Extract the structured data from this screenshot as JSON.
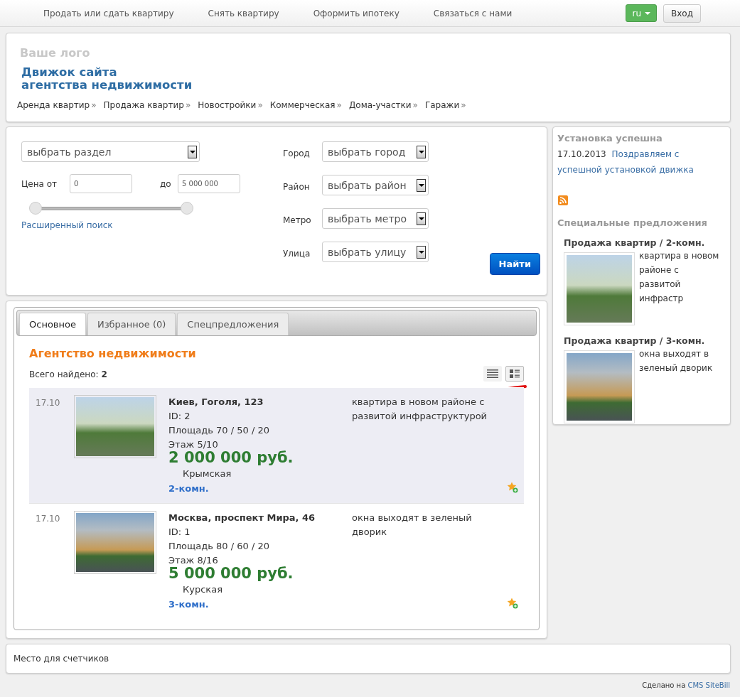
{
  "top_nav": {
    "links": [
      "Продать или сдать квартиру",
      "Снять квартиру",
      "Оформить ипотеку",
      "Связаться с нами"
    ],
    "language": "ru",
    "login": "Вход"
  },
  "header": {
    "logo": "Ваше лого",
    "title_lines": [
      "Движок сайта",
      "агентства недвижимости"
    ],
    "menu": [
      "Аренда квартир",
      "Продажа квартир",
      "Новостройки",
      "Коммерческая",
      "Дома-участки",
      "Гаражи"
    ],
    "menu_arrow": "»"
  },
  "search": {
    "section": {
      "value": "выбрать раздел"
    },
    "price_from": {
      "label": "Цена от",
      "value": "0"
    },
    "price_to": {
      "label": "до",
      "value": "5 000 000"
    },
    "slider": {
      "thumbs": [
        {
          "level": 0
        },
        {
          "level": 1
        }
      ]
    },
    "advanced_link": "Расширенный поиск",
    "filters": [
      {
        "label": "Город",
        "value": "выбрать город"
      },
      {
        "label": "Район",
        "value": "выбрать район"
      },
      {
        "label": "Метро",
        "value": "выбрать метро"
      },
      {
        "label": "Улица",
        "value": "выбрать улицу"
      }
    ],
    "submit": "Найти"
  },
  "tabs": [
    {
      "label": "Основное",
      "selected": true
    },
    {
      "label": "Избранное (0)",
      "selected": false
    },
    {
      "label": "Спецпредложения",
      "selected": false
    }
  ],
  "listing": {
    "heading": "Агентство недвижимости",
    "total_label": "Всего найдено:",
    "total": "2",
    "views": [
      {
        "kind": "list",
        "selected": false
      },
      {
        "kind": "grid",
        "selected": true
      }
    ],
    "rows": [
      {
        "date": "17.10",
        "title": "Киев, Гоголя, 123",
        "id": "ID: 2",
        "area": "Площадь 70 / 50 / 20",
        "floor": "Этаж 5/10",
        "price": "2 000 000 руб.",
        "metro": "Крымская",
        "rooms": "2-комн.",
        "description": "квартира в новом районе с развитой инфраструктурой",
        "highlighted": true
      },
      {
        "date": "17.10",
        "title": "Москва, проспект Мира, 46",
        "id": "ID: 1",
        "area": "Площадь 80 / 60 / 20",
        "floor": "Этаж 8/16",
        "price": "5 000 000 руб.",
        "metro": "Курская",
        "rooms": "3-комн.",
        "description": "окна выходят в зеленый дворик",
        "highlighted": false
      }
    ]
  },
  "sidebar": {
    "news_heading": "Установка успешна",
    "news": [
      {
        "date": "17.10.2013",
        "link": "Поздравляем с успешной установкой движка"
      }
    ],
    "special_heading": "Специальные предложения",
    "specials": [
      {
        "title": "Продажа квартир / 2-комн.",
        "text": "квартира в новом районе с развитой инфрастр"
      },
      {
        "title": "Продажа квартир / 3-комн.",
        "text": "окна выходят в зеленый дворик"
      }
    ]
  },
  "counters": "Место для счетчиков",
  "credit": {
    "text": "Сделано на",
    "link": "CMS SiteBill"
  }
}
